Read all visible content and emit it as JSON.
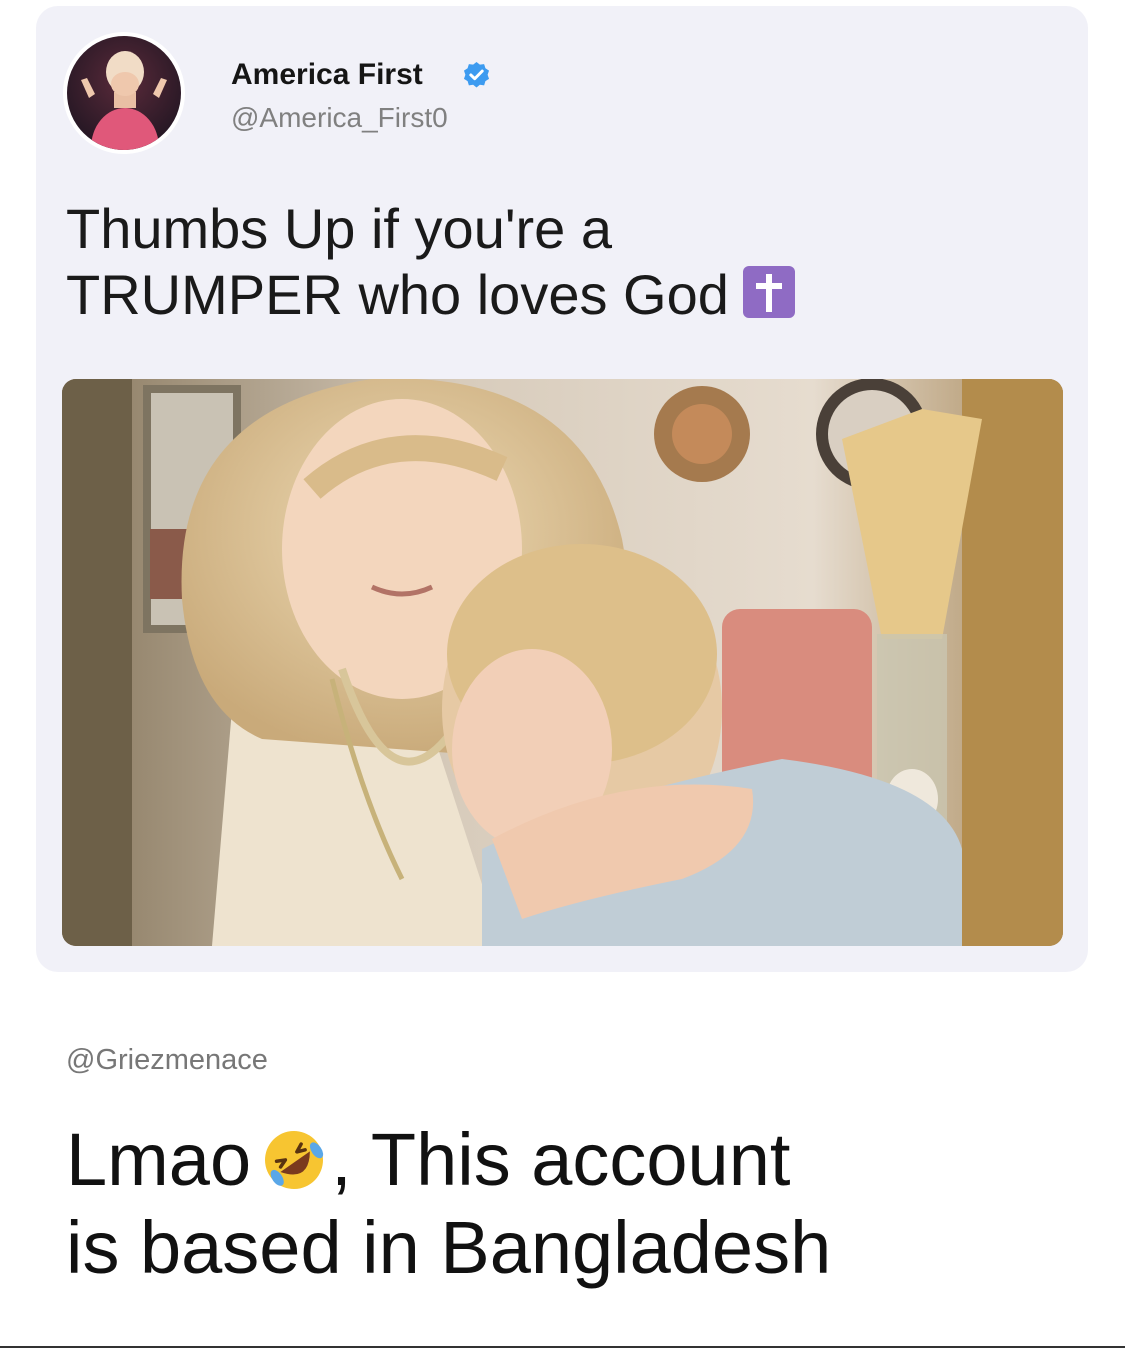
{
  "tweet": {
    "author": {
      "name": "America First",
      "handle": "@America_First0",
      "verified": true,
      "avatar": "woman-in-pink-dress-avatar"
    },
    "text_line1": "Thumbs Up if you're a",
    "text_line2": "TRUMPER who loves God",
    "text_emoji": "latin-cross-emoji",
    "photo": "woman-hugging-child-photo"
  },
  "reply": {
    "handle": "@Griezmenace",
    "text_prefix": "Lmao",
    "text_emoji": "rolling-on-floor-laughing-emoji",
    "text_suffix": ", This account",
    "text_line2": "is based in Bangladesh"
  },
  "colors": {
    "card_background": "#f1f1f8",
    "verified_blue": "#3d9bf0",
    "cross_purple": "#8f6bc4",
    "handle_gray": "#808080"
  }
}
